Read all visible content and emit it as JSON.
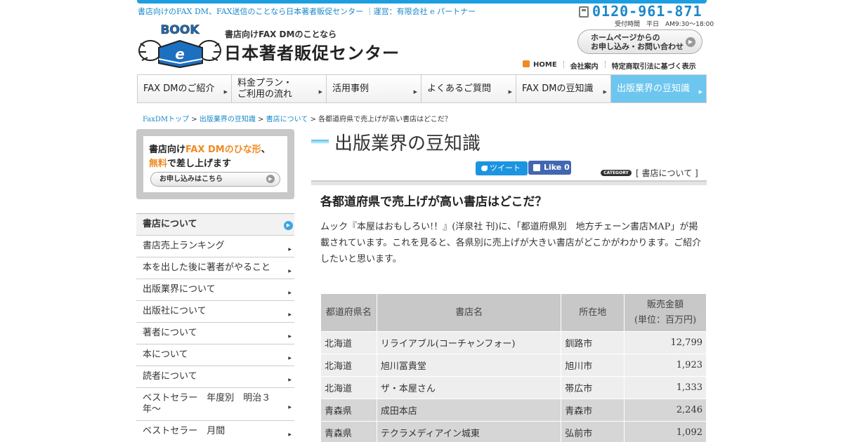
{
  "header": {
    "caption": "書店向けのFAX DM、FAX送信のことなら日本著者販促センター ｜運営：有限会社 e パートナー",
    "logo_text": "BOOK",
    "logo_mark": "e",
    "logo_sub": "書店向けFAX DMのことなら",
    "site_title": "日本著者販促センター",
    "phone": "0120-961-871",
    "hours": "受付時間　平日　AM9:30〜18:00",
    "contact_line1": "ホームページからの",
    "contact_line2": "お申し込み・お問い合わせ",
    "links": [
      "HOME",
      "会社案内",
      "特定商取引法に基づく表示"
    ]
  },
  "gnav": [
    {
      "line1": "FAX DMのご紹介",
      "line2": ""
    },
    {
      "line1": "料金プラン・",
      "line2": "ご利用の流れ"
    },
    {
      "line1": "活用事例",
      "line2": ""
    },
    {
      "line1": "よくあるご質問",
      "line2": ""
    },
    {
      "line1": "FAX DMの豆知識",
      "line2": ""
    },
    {
      "line1": "出版業界の豆知識",
      "line2": ""
    }
  ],
  "breadcrumb": {
    "items": [
      "FaxDMトップ",
      "出版業界の豆知識",
      "書店について"
    ],
    "current": "各都道府県で売上げが高い書店はどこだ？"
  },
  "banner": {
    "line1_a": "書店向け",
    "line1_b": "FAX DMのひな形",
    "line1_c": "、",
    "line2_a": "無料",
    "line2_b": "で差し上げます",
    "button": "お申し込みはこちら"
  },
  "sidebar": [
    "書店について",
    "書店売上ランキング",
    "本を出した後に著者がやること",
    "出版業界について",
    "出版社について",
    "著者について",
    "本について",
    "読者について",
    "ベストセラー　年度別　明治３年～",
    "ベストセラー　月間"
  ],
  "section": {
    "title": "出版業界の豆知識",
    "tweet": "ツイート",
    "like": "Like 0",
    "category_badge": "CATEGORY",
    "category": "[ 書店について ]"
  },
  "article": {
    "title": "各都道府県で売上げが高い書店はどこだ？",
    "body": "ムック『本屋はおもしろい!！』(洋泉社 刊)に、「都道府県別　地方チェーン書店MAP」が掲載されています。これを見ると、各県別に売上げが大きい書店がどこかがわかります。ご紹介したいと思います。"
  },
  "table": {
    "headers": [
      "都道府県名",
      "書店名",
      "所在地",
      "販売金額",
      "(単位：百万円)"
    ],
    "rows": [
      [
        "北海道",
        "リライアブル(コーチャンフォー)",
        "釧路市",
        "12,799"
      ],
      [
        "北海道",
        "旭川冨貴堂",
        "旭川市",
        "1,923"
      ],
      [
        "北海道",
        "ザ・本屋さん",
        "帯広市",
        "1,333"
      ],
      [
        "青森県",
        "成田本店",
        "青森市",
        "2,246"
      ],
      [
        "青森県",
        "テクラメディアイン城東",
        "弘前市",
        "1,092"
      ]
    ]
  },
  "colors": {
    "accent": "#1a88c9",
    "active_nav": "#6cc6ef",
    "orange": "#f08a24"
  }
}
